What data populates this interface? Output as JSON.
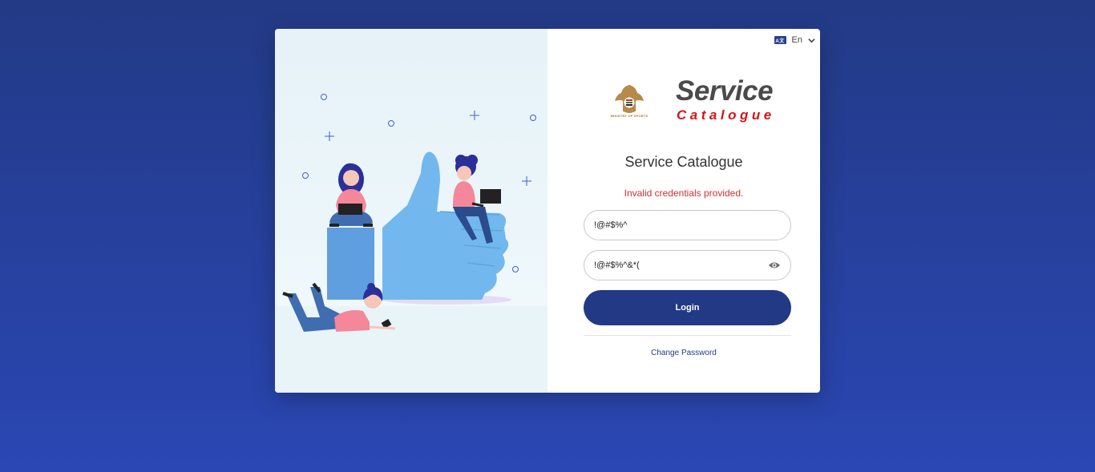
{
  "language": {
    "icon": "translate-icon",
    "icon_text": "A文",
    "label": "En"
  },
  "brand": {
    "emblem_text": "MINISTRY OF SPORTS",
    "name_main": "Service",
    "name_sub": "Catalogue"
  },
  "form": {
    "title": "Service Catalogue",
    "error": "Invalid credentials provided.",
    "username_value": "!@#$%^",
    "password_value": "!@#$%^&*(",
    "login_label": "Login",
    "change_password_label": "Change Password"
  },
  "colors": {
    "background_top": "#233a86",
    "background_bottom": "#2a47b3",
    "primary": "#223a85",
    "error": "#d32f2f",
    "brand_red": "#d4141b"
  }
}
